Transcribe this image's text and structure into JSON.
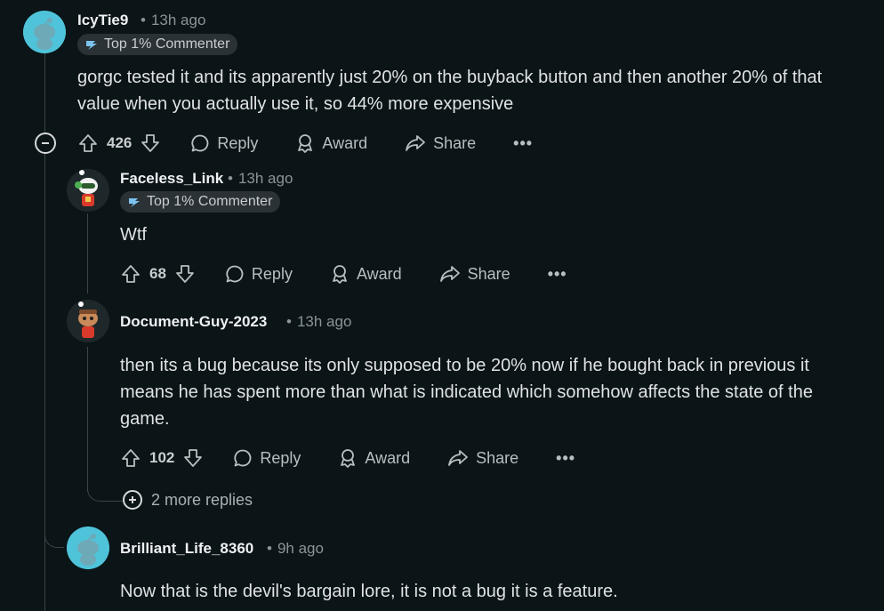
{
  "comments": [
    {
      "username": "IcyTie9",
      "time": "13h ago",
      "flair": "Top 1% Commenter",
      "body": "gorgc tested it and its apparently just 20% on the buyback button and then another 20% of that value when you actually use it, so 44% more expensive",
      "votes": "426",
      "reply_label": "Reply",
      "award_label": "Award",
      "share_label": "Share",
      "more_label": "•••"
    },
    {
      "username": "Faceless_Link",
      "time": "13h ago",
      "flair": "Top 1% Commenter",
      "body": "Wtf",
      "votes": "68",
      "reply_label": "Reply",
      "award_label": "Award",
      "share_label": "Share",
      "more_label": "•••"
    },
    {
      "username": "Document-Guy-2023",
      "time": "13h ago",
      "body": "then its a bug because its only supposed to be 20% now if he bought back in previous it means he has spent more than what is indicated which somehow affects the state of the game.",
      "votes": "102",
      "reply_label": "Reply",
      "award_label": "Award",
      "share_label": "Share",
      "more_label": "•••"
    },
    {
      "username": "Brilliant_Life_8360",
      "time": "9h ago",
      "body": "Now that is the devil's bargain lore, it is not a bug it is a feature."
    }
  ],
  "more_replies": "2 more replies",
  "dot": "•",
  "colors": {
    "background": "#0b1416",
    "snoo_bg": "#4fc3d9",
    "thread_line": "#3c4446"
  }
}
